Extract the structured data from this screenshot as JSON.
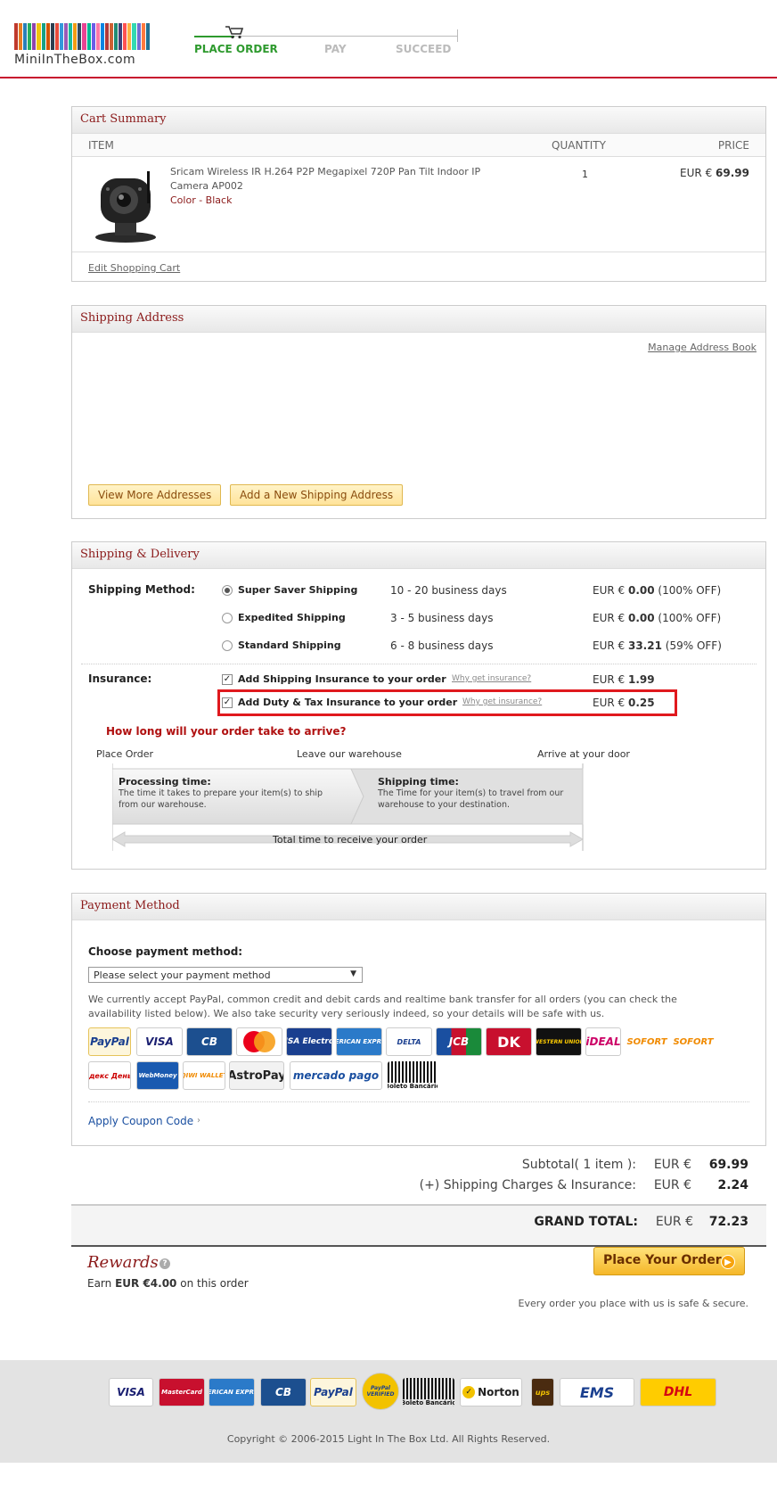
{
  "header": {
    "logo_text": "MiniInTheBox.com",
    "logo_colors": [
      "#c0392b",
      "#e67e22",
      "#2980b9",
      "#27ae60",
      "#8e44ad",
      "#f1c40f",
      "#16a085",
      "#d35400",
      "#2c3e50",
      "#e74c3c",
      "#3498db",
      "#9b59b6",
      "#1abc9c",
      "#f39c12",
      "#34495e",
      "#e84393",
      "#00b894",
      "#6c5ce7",
      "#fd79a8",
      "#0984e3",
      "#b33939",
      "#cd6133",
      "#218c74",
      "#40407a",
      "#ff5252",
      "#ffb142",
      "#33d9b2",
      "#706fd3",
      "#ff793f",
      "#227093"
    ],
    "steps": [
      {
        "label": "PLACE ORDER",
        "active": true
      },
      {
        "label": "PAY",
        "active": false
      },
      {
        "label": "SUCCEED",
        "active": false
      }
    ]
  },
  "cart": {
    "title": "Cart Summary",
    "col_item": "ITEM",
    "col_qty": "QUANTITY",
    "col_price": "PRICE",
    "item_name_1": "Sricam Wireless IR H.264 P2P Megapixel 720P Pan Tilt Indoor IP",
    "item_name_2": "Camera AP002",
    "item_color": "Color - Black",
    "item_qty": "1",
    "currency": "EUR €",
    "item_price": "69.99",
    "edit_link": "Edit Shopping Cart"
  },
  "address": {
    "title": "Shipping Address",
    "manage_link": "Manage Address Book",
    "view_more": "View More Addresses",
    "add_new": "Add a New Shipping Address"
  },
  "shipping": {
    "title": "Shipping & Delivery",
    "method_label": "Shipping Method:",
    "methods": [
      {
        "name": "Super Saver Shipping",
        "days": "10 - 20 business days",
        "cur": "EUR €",
        "price": "0.00",
        "off": "(100% OFF)",
        "selected": true
      },
      {
        "name": "Expedited Shipping",
        "days": "3 - 5 business days",
        "cur": "EUR €",
        "price": "0.00",
        "off": "(100% OFF)",
        "selected": false
      },
      {
        "name": "Standard Shipping",
        "days": "6 - 8 business days",
        "cur": "EUR €",
        "price": "33.21",
        "off": "(59% OFF)",
        "selected": false
      }
    ],
    "insurance_label": "Insurance:",
    "insurance": [
      {
        "label": "Add Shipping Insurance to your order",
        "why": "Why get insurance?",
        "cur": "EUR €",
        "price": "1.99",
        "checked": true
      },
      {
        "label": "Add Duty & Tax Insurance to your order",
        "why": "Why get insurance?",
        "cur": "EUR €",
        "price": "0.25",
        "checked": true
      }
    ],
    "arrive_q": "How long will your order take to arrive?",
    "place_order": "Place Order",
    "leave_wh": "Leave our warehouse",
    "arrive_door": "Arrive at your door",
    "proc_title": "Processing time:",
    "proc_1": "The time it takes to prepare your item(s) to ship",
    "proc_2": "from our warehouse.",
    "ship_title": "Shipping time:",
    "ship_1": "The Time for your item(s) to travel from our",
    "ship_2": "warehouse to your destination.",
    "total_time": "Total time to receive your order"
  },
  "payment": {
    "title": "Payment Method",
    "choose": "Choose payment method:",
    "select_value": "Please select your payment method",
    "desc_1": "We currently accept PayPal, common credit and debit cards and realtime bank transfer for all orders (you can check the",
    "desc_2": "availability listed below). We also take security very seriously indeed, so your details will be safe with us.",
    "logos_row1": [
      "PayPal",
      "VISA",
      "CB",
      "MasterCard",
      "VISA Electron",
      "AMERICAN EXPRESS",
      "DELTA",
      "JCB",
      "DK",
      "WESTERN UNION",
      "iDEAL",
      "SOFORT",
      "SOFORT"
    ],
    "logos_row2": [
      "Яндекс Деньги",
      "WebMoney",
      "QIWI WALLET",
      "AstroPay",
      "mercado pago",
      "Boleto Bancário"
    ],
    "coupon": "Apply Coupon Code"
  },
  "totals": {
    "subtotal_label": "Subtotal( 1 item ):",
    "cur": "EUR €",
    "subtotal": "69.99",
    "ship_label": "(+) Shipping Charges & Insurance:",
    "ship": "2.24",
    "grand_label": "GRAND TOTAL:",
    "grand": "72.23"
  },
  "rewards": {
    "title": "Rewards",
    "earn_pre": "Earn",
    "earn_amt": "EUR €4.00",
    "earn_post": "on this order"
  },
  "place_btn": "Place Your Order",
  "secure_note": "Every order you place with us is safe & secure.",
  "footer": {
    "logos": [
      "VISA",
      "MasterCard",
      "AMERICAN EXPRESS",
      "CB",
      "PayPal",
      "PayPal VERIFIED",
      "Boleto Bancário",
      "Norton",
      "ups",
      "EMS",
      "DHL"
    ],
    "copyright": "Copyright © 2006-2015 Light In The Box Ltd. All Rights Reserved."
  }
}
